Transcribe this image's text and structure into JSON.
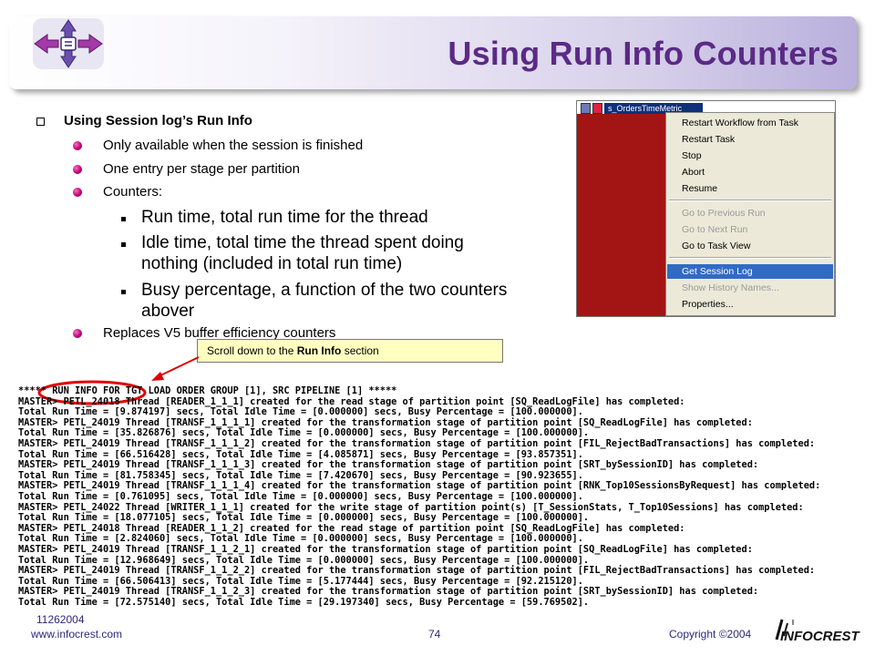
{
  "slide": {
    "title": "Using Run Info Counters",
    "logo_icon": "workflow-arrows-logo-icon"
  },
  "bullets": {
    "level1": "Using Session log’s Run Info",
    "level2": [
      "Only available when the session is finished",
      "One entry per stage per partition",
      "Counters:"
    ],
    "level3": [
      "Run time, total run time for the thread",
      "Idle time, total time the thread spent doing",
      "nothing (included in total run time)",
      "Busy percentage, a function of the two counters",
      "abover"
    ],
    "last_level2": "Replaces V5 buffer efficiency counters"
  },
  "context_menu": {
    "task_name": "s_OrdersTimeMetric",
    "items": [
      {
        "label": "Restart Workflow from Task",
        "enabled": true
      },
      {
        "label": "Restart Task",
        "enabled": true
      },
      {
        "label": "Stop",
        "enabled": true
      },
      {
        "label": "Abort",
        "enabled": true
      },
      {
        "label": "Resume",
        "enabled": true
      },
      {
        "label": "Go to Previous Run",
        "enabled": false
      },
      {
        "label": "Go to  Next Run",
        "enabled": false
      },
      {
        "label": "Go to Task View",
        "enabled": true
      },
      {
        "label": "Get Session Log",
        "enabled": true,
        "highlighted": true
      },
      {
        "label": "Show History Names...",
        "enabled": false
      },
      {
        "label": "Properties...",
        "enabled": true
      }
    ]
  },
  "callout": {
    "before": "Scroll down to the ",
    "bold": "Run Info",
    "after": " section"
  },
  "log_lines": [
    "***** RUN INFO FOR TGT LOAD ORDER GROUP [1], SRC PIPELINE [1] *****",
    "MASTER> PETL_24018 Thread [READER_1_1_1] created for the read stage of partition point [SQ_ReadLogFile] has completed:",
    "Total Run Time = [9.874197] secs, Total Idle Time = [0.000000] secs, Busy Percentage = [100.000000].",
    "MASTER> PETL_24019 Thread [TRANSF_1_1_1_1] created for the transformation stage of partition point [SQ_ReadLogFile] has completed:",
    "Total Run Time = [35.826876] secs, Total Idle Time = [0.000000] secs, Busy Percentage = [100.000000].",
    "MASTER> PETL_24019 Thread [TRANSF_1_1_1_2] created for the transformation stage of partition point [FIL_RejectBadTransactions] has completed:",
    "Total Run Time = [66.516428] secs, Total Idle Time = [4.085871] secs, Busy Percentage = [93.857351].",
    "MASTER> PETL_24019 Thread [TRANSF_1_1_1_3] created for the transformation stage of partition point [SRT_bySessionID] has completed:",
    "Total Run Time = [81.758345] secs, Total Idle Time = [7.420670] secs, Busy Percentage = [90.923655].",
    "MASTER> PETL_24019 Thread [TRANSF_1_1_1_4] created for the transformation stage of partition point [RNK_Top10SessionsByRequest] has completed:",
    "Total Run Time = [0.761095] secs, Total Idle Time = [0.000000] secs, Busy Percentage = [100.000000].",
    "MASTER> PETL_24022 Thread [WRITER_1_1_1] created for the write stage of partition point(s) [T_SessionStats, T_Top10Sessions] has completed:",
    "Total Run Time = [18.077105] secs, Total Idle Time = [0.000000] secs, Busy Percentage = [100.000000].",
    "MASTER> PETL_24018 Thread [READER_1_1_2] created for the read stage of partition point [SQ_ReadLogFile] has completed:",
    "Total Run Time = [2.824060] secs, Total Idle Time = [0.000000] secs, Busy Percentage = [100.000000].",
    "MASTER> PETL_24019 Thread [TRANSF_1_1_2_1] created for the transformation stage of partition point [SQ_ReadLogFile] has completed:",
    "Total Run Time = [12.968649] secs, Total Idle Time = [0.000000] secs, Busy Percentage = [100.000000].",
    "MASTER> PETL_24019 Thread [TRANSF_1_1_2_2] created for the transformation stage of partition point [FIL_RejectBadTransactions] has completed:",
    "Total Run Time = [66.506413] secs, Total Idle Time = [5.177444] secs, Busy Percentage = [92.215120].",
    "MASTER> PETL_24019 Thread [TRANSF_1_1_2_3] created for the transformation stage of partition point [SRT_bySessionID] has completed:",
    "Total Run Time = [72.575140] secs, Total Idle Time = [29.197340] secs, Busy Percentage = [59.769502]."
  ],
  "footer": {
    "date": "11262004",
    "url": "www.infocrest.com",
    "page": "74",
    "copyright": "Copyright ©2004",
    "brand": "INFOCREST"
  },
  "colors": {
    "title": "#5b2a86",
    "bullet_dot": "#c0007a",
    "menu_highlight": "#316ac5",
    "panel_red": "#a31515",
    "callout_bg": "#ffffc0",
    "annotation_red": "#e00000"
  }
}
